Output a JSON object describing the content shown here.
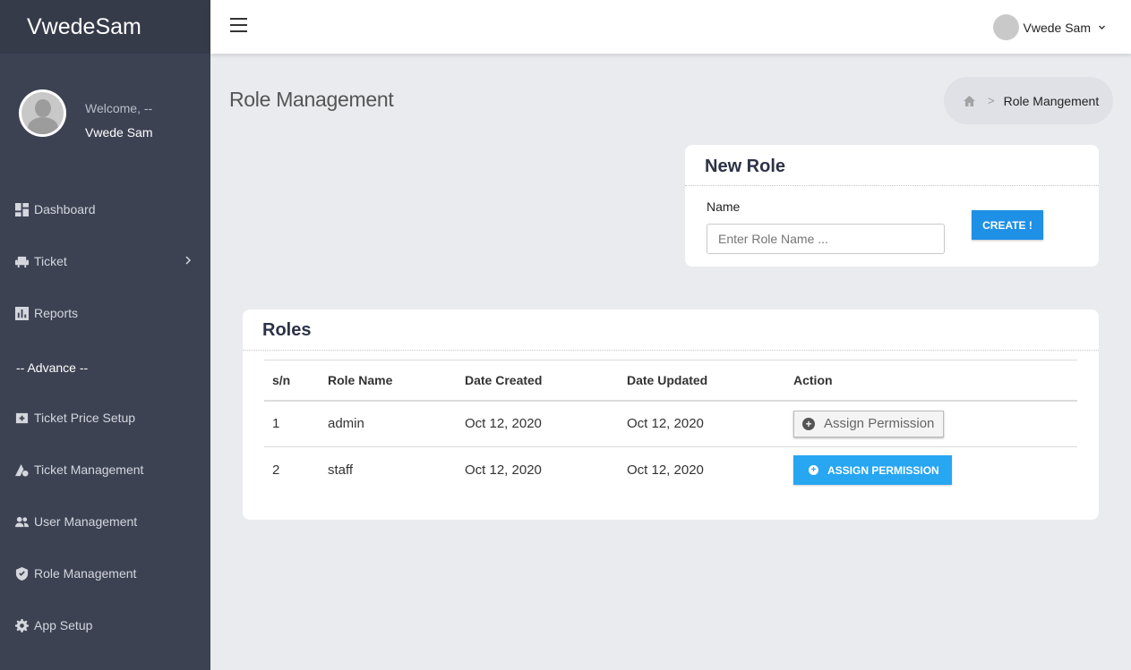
{
  "brand": "VwedeSam",
  "profile": {
    "welcome": "Welcome, --",
    "name": "Vwede Sam"
  },
  "sidebar": {
    "items": [
      {
        "label": "Dashboard",
        "icon": "dashboard-icon"
      },
      {
        "label": "Ticket",
        "icon": "seat-icon"
      },
      {
        "label": "Reports",
        "icon": "chart-icon"
      }
    ],
    "advance_heading": "-- Advance --",
    "advance_items": [
      {
        "label": "Ticket Price Setup",
        "icon": "price-tag-icon"
      },
      {
        "label": "Ticket Management",
        "icon": "ticket-manage-icon"
      },
      {
        "label": "User Management",
        "icon": "users-icon"
      },
      {
        "label": "Role Management",
        "icon": "shield-icon"
      },
      {
        "label": "App Setup",
        "icon": "gear-icon"
      }
    ]
  },
  "topbar": {
    "user_name": "Vwede Sam"
  },
  "page": {
    "title": "Role Management"
  },
  "breadcrumb": {
    "current": "Role Mangement"
  },
  "new_role": {
    "title": "New Role",
    "name_label": "Name",
    "placeholder": "Enter Role Name ...",
    "create_label": "CREATE !"
  },
  "roles": {
    "title": "Roles",
    "columns": [
      "s/n",
      "Role Name",
      "Date Created",
      "Date Updated",
      "Action"
    ],
    "rows": [
      {
        "sn": "1",
        "name": "admin",
        "created": "Oct 12, 2020",
        "updated": "Oct 12, 2020",
        "action": "Assign Permission"
      },
      {
        "sn": "2",
        "name": "staff",
        "created": "Oct 12, 2020",
        "updated": "Oct 12, 2020",
        "action": "ASSIGN PERMISSION"
      }
    ]
  },
  "colors": {
    "sidebar": "#3d4253",
    "brand_bar": "#363b4a",
    "primary": "#1e90e6",
    "accent": "#27a6f2"
  }
}
